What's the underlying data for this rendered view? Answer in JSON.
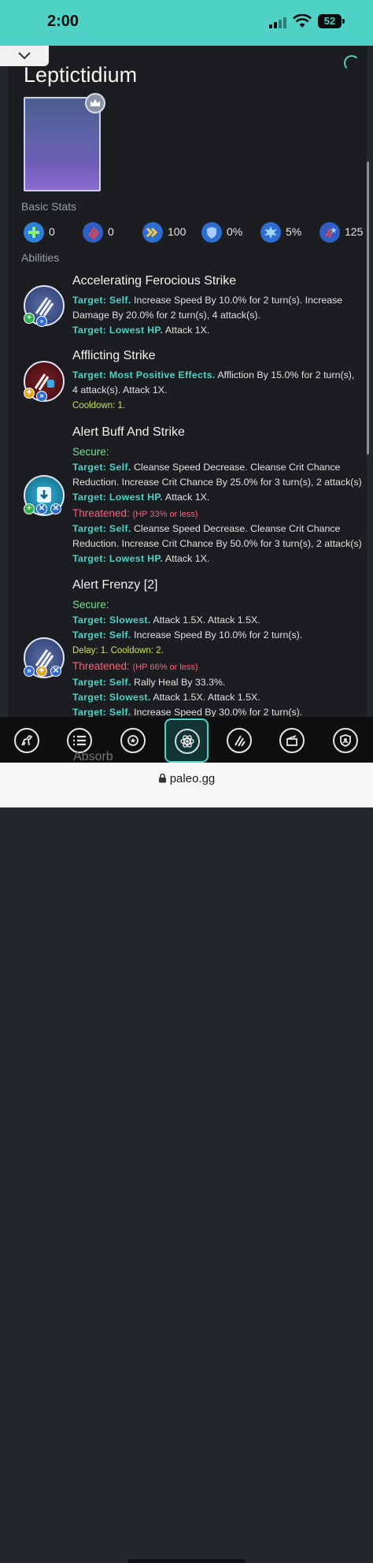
{
  "status_bar": {
    "time": "2:00",
    "battery": "52"
  },
  "creature": {
    "name": "Leptictidium"
  },
  "sections": {
    "basic_stats": "Basic Stats",
    "abilities": "Abilities"
  },
  "stats": [
    {
      "icon": "health-plus-icon",
      "value": "0"
    },
    {
      "icon": "claw-damage-icon",
      "value": "0"
    },
    {
      "icon": "speed-chevrons-icon",
      "value": "100"
    },
    {
      "icon": "armor-shield-icon",
      "value": "0%"
    },
    {
      "icon": "crit-burst-icon",
      "value": "5%"
    },
    {
      "icon": "crit-damage-icon",
      "value": "125"
    }
  ],
  "abilities": [
    {
      "name": "Accelerating Ferocious Strike",
      "lines": [
        {
          "target": "Target: Self.",
          "text": " Increase Speed By 10.0% for 2 turn(s). Increase"
        },
        {
          "target": "",
          "text": "Damage By 20.0% for 2 turn(s), 4 attack(s)."
        },
        {
          "target": "Target: Lowest HP.",
          "text": " Attack 1X."
        }
      ]
    },
    {
      "name": "Afflicting Strike",
      "lines": [
        {
          "target": "Target: Most Positive Effects.",
          "text": " Affliction By 15.0% for 2 turn(s),"
        },
        {
          "target": "",
          "text": "4 attack(s). Attack 1X."
        }
      ],
      "cooldown": "Cooldown: 1."
    },
    {
      "name": "Alert Buff And Strike",
      "secure": "Secure:",
      "secure_lines": [
        {
          "target": "Target: Self.",
          "text": " Cleanse Speed Decrease. Cleanse Crit Chance"
        },
        {
          "target": "",
          "text": "Reduction. Increase Crit Chance By 25.0% for 3 turn(s), 2 attack(s)"
        },
        {
          "target": "Target: Lowest HP.",
          "text": " Attack 1X."
        }
      ],
      "threatened": "Threatened:",
      "threatened_note": "(HP 33% or less)",
      "threatened_lines": [
        {
          "target": "Target: Self.",
          "text": " Cleanse Speed Decrease. Cleanse Crit Chance"
        },
        {
          "target": "",
          "text": "Reduction. Increase Crit Chance By 50.0% for 3 turn(s), 2 attack(s)"
        },
        {
          "target": "Target: Lowest HP.",
          "text": " Attack 1X."
        }
      ]
    },
    {
      "name": "Alert Frenzy [2]",
      "secure": "Secure:",
      "secure_lines": [
        {
          "target": "Target: Slowest.",
          "text": " Attack 1.5X. Attack 1.5X."
        },
        {
          "target": "Target: Self.",
          "text": " Increase Speed By 10.0% for 2 turn(s)."
        }
      ],
      "secure_cooldown": "Delay: 1. Cooldown: 2.",
      "threatened": "Threatened:",
      "threatened_note": "(HP 66% or less)",
      "threatened_lines": [
        {
          "target": "Target: Self.",
          "text": " Rally Heal By 33.3%."
        },
        {
          "target": "Target: Slowest.",
          "text": " Attack 1.5X. Attack 1.5X."
        },
        {
          "target": "Target: Self.",
          "text": " Increase Speed By 30.0% for 2 turn(s)."
        }
      ]
    }
  ],
  "next_ability_peek": "Absorb",
  "tabs": [
    {
      "icon": "dinosaur-icon"
    },
    {
      "icon": "list-icon"
    },
    {
      "icon": "achievement-badge-icon"
    },
    {
      "icon": "atom-icon",
      "active": true
    },
    {
      "icon": "claw-icon"
    },
    {
      "icon": "clapperboard-icon"
    },
    {
      "icon": "shield-badge-icon"
    }
  ],
  "browser": {
    "url": "paleo.gg"
  },
  "colors": {
    "accent": "#4fd1c5",
    "secure": "#6fe38a",
    "threatened": "#ff5f7a",
    "cooldown": "#c8e35a"
  }
}
